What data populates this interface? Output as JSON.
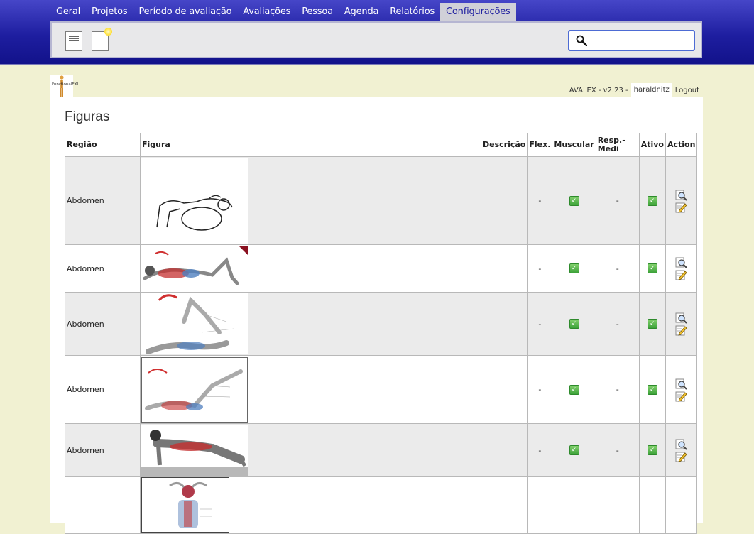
{
  "nav": {
    "items": [
      {
        "label": "Geral"
      },
      {
        "label": "Projetos"
      },
      {
        "label": "Período de avaliação"
      },
      {
        "label": "Avaliações"
      },
      {
        "label": "Pessoa"
      },
      {
        "label": "Agenda"
      },
      {
        "label": "Relatórios"
      },
      {
        "label": "Configurações",
        "active": true
      }
    ]
  },
  "search": {
    "value": ""
  },
  "logo": {
    "text": "FunctionalEXI"
  },
  "userbar": {
    "version": "AVALEX - v2.23 -",
    "user": "haraldnitz",
    "logout": "Logout"
  },
  "page": {
    "title": "Figuras"
  },
  "table": {
    "headers": [
      "Região",
      "Figura",
      "Descrição",
      "Flex.",
      "Muscular",
      "Resp.-Medi",
      "Ativo",
      "Action"
    ],
    "rows": [
      {
        "regiao": "Abdomen",
        "descricao": "",
        "flex": "-",
        "muscular": true,
        "resp": "-",
        "ativo": true
      },
      {
        "regiao": "Abdomen",
        "descricao": "",
        "flex": "-",
        "muscular": true,
        "resp": "-",
        "ativo": true
      },
      {
        "regiao": "Abdomen",
        "descricao": "",
        "flex": "-",
        "muscular": true,
        "resp": "-",
        "ativo": true
      },
      {
        "regiao": "Abdomen",
        "descricao": "",
        "flex": "-",
        "muscular": true,
        "resp": "-",
        "ativo": true
      },
      {
        "regiao": "Abdomen",
        "descricao": "",
        "flex": "-",
        "muscular": true,
        "resp": "-",
        "ativo": true
      },
      {
        "regiao": "",
        "descricao": "",
        "flex": "",
        "muscular": false,
        "resp": "",
        "ativo": false
      }
    ]
  },
  "colors": {
    "nav_bg": "#1e1ea0",
    "accent": "#4d6bd4",
    "page_bg": "#f1f1d2",
    "check": "#3da23a"
  },
  "icons": {
    "list": "document-list-icon",
    "new": "new-document-icon",
    "search": "search-icon",
    "view": "magnifier-view-icon",
    "edit": "edit-pencil-icon",
    "check": "checkbox-checked-icon"
  }
}
